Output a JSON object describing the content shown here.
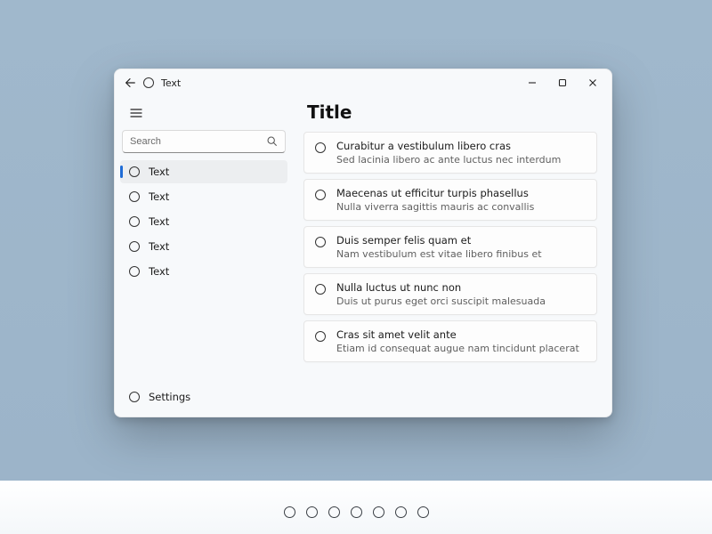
{
  "titlebar": {
    "title": "Text"
  },
  "sidebar": {
    "search_placeholder": "Search",
    "items": [
      {
        "label": "Text",
        "selected": true
      },
      {
        "label": "Text",
        "selected": false
      },
      {
        "label": "Text",
        "selected": false
      },
      {
        "label": "Text",
        "selected": false
      },
      {
        "label": "Text",
        "selected": false
      }
    ],
    "settings_label": "Settings"
  },
  "content": {
    "title": "Title",
    "cards": [
      {
        "line1": "Curabitur a vestibulum libero cras",
        "line2": "Sed lacinia libero ac ante luctus nec interdum"
      },
      {
        "line1": "Maecenas ut efficitur turpis phasellus",
        "line2": "Nulla viverra sagittis mauris ac convallis"
      },
      {
        "line1": "Duis semper felis quam et",
        "line2": "Nam vestibulum est vitae libero finibus et"
      },
      {
        "line1": "Nulla luctus ut nunc non",
        "line2": "Duis ut purus eget orci suscipit malesuada"
      },
      {
        "line1": "Cras sit amet velit ante",
        "line2": "Etiam id consequat augue nam tincidunt placerat"
      }
    ]
  },
  "footer": {
    "dot_count": 7
  }
}
